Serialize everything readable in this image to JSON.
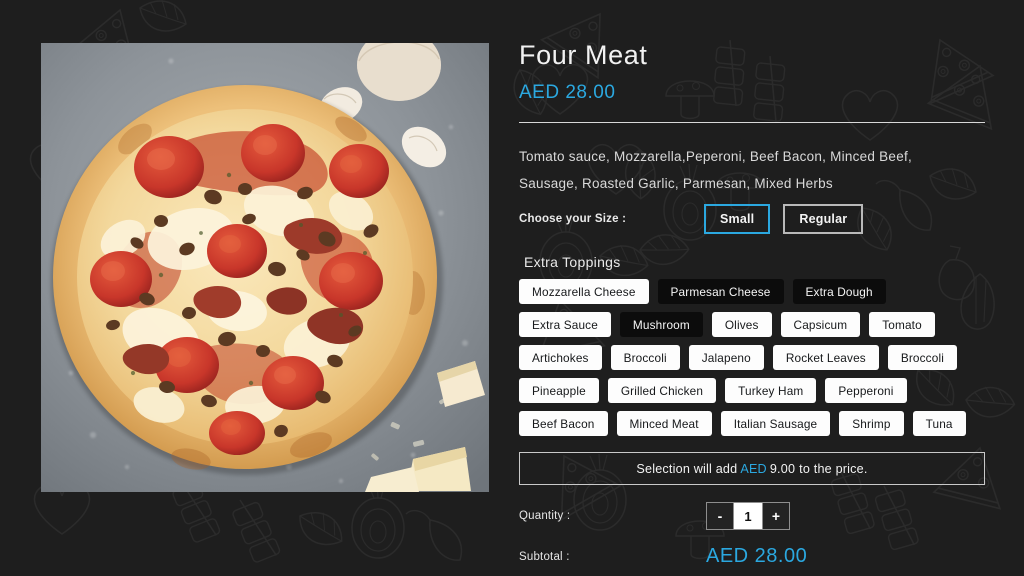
{
  "product": {
    "title": "Four Meat",
    "price": "AED 28.00",
    "description": "Tomato sauce, Mozzarella,Peperoni, Beef Bacon, Minced Beef, Sausage, Roasted Garlic, Parmesan, Mixed Herbs",
    "image_alt": "four-meat-pizza-photo"
  },
  "size": {
    "label": "Choose your Size :",
    "options": [
      {
        "label": "Small",
        "selected": true
      },
      {
        "label": "Regular",
        "selected": false
      }
    ]
  },
  "toppings": {
    "heading": "Extra Toppings",
    "items": [
      {
        "label": "Mozzarella Cheese",
        "selected": false
      },
      {
        "label": "Parmesan Cheese",
        "selected": true
      },
      {
        "label": "Extra Dough",
        "selected": true
      },
      {
        "label": "Extra Sauce",
        "selected": false
      },
      {
        "label": "Mushroom",
        "selected": true
      },
      {
        "label": "Olives",
        "selected": false
      },
      {
        "label": "Capsicum",
        "selected": false
      },
      {
        "label": "Tomato",
        "selected": false
      },
      {
        "label": "Artichokes",
        "selected": false
      },
      {
        "label": "Broccoli",
        "selected": false
      },
      {
        "label": "Jalapeno",
        "selected": false
      },
      {
        "label": "Rocket Leaves",
        "selected": false
      },
      {
        "label": "Broccoli",
        "selected": false
      },
      {
        "label": "Pineapple",
        "selected": false
      },
      {
        "label": "Grilled Chicken",
        "selected": false
      },
      {
        "label": "Turkey Ham",
        "selected": false
      },
      {
        "label": "Pepperoni",
        "selected": false
      },
      {
        "label": "Beef Bacon",
        "selected": false
      },
      {
        "label": "Minced Meat",
        "selected": false
      },
      {
        "label": "Italian Sausage",
        "selected": false
      },
      {
        "label": "Shrimp",
        "selected": false
      },
      {
        "label": "Tuna",
        "selected": false
      }
    ]
  },
  "selection_note": {
    "prefix": "Selection will add",
    "currency": "AED",
    "amount": "9.00",
    "suffix": "to the price."
  },
  "quantity": {
    "label": "Quantity :",
    "decrement_label": "-",
    "value": "1",
    "increment_label": "+"
  },
  "subtotal": {
    "label": "Subtotal :",
    "value": "AED 28.00"
  },
  "colors": {
    "background": "#1e1e1e",
    "accent_blue": "#2ba8e0",
    "chip_off_bg": "#fdfdfd",
    "chip_on_bg": "#0c0c0c",
    "text_primary": "#f2f2f2"
  }
}
